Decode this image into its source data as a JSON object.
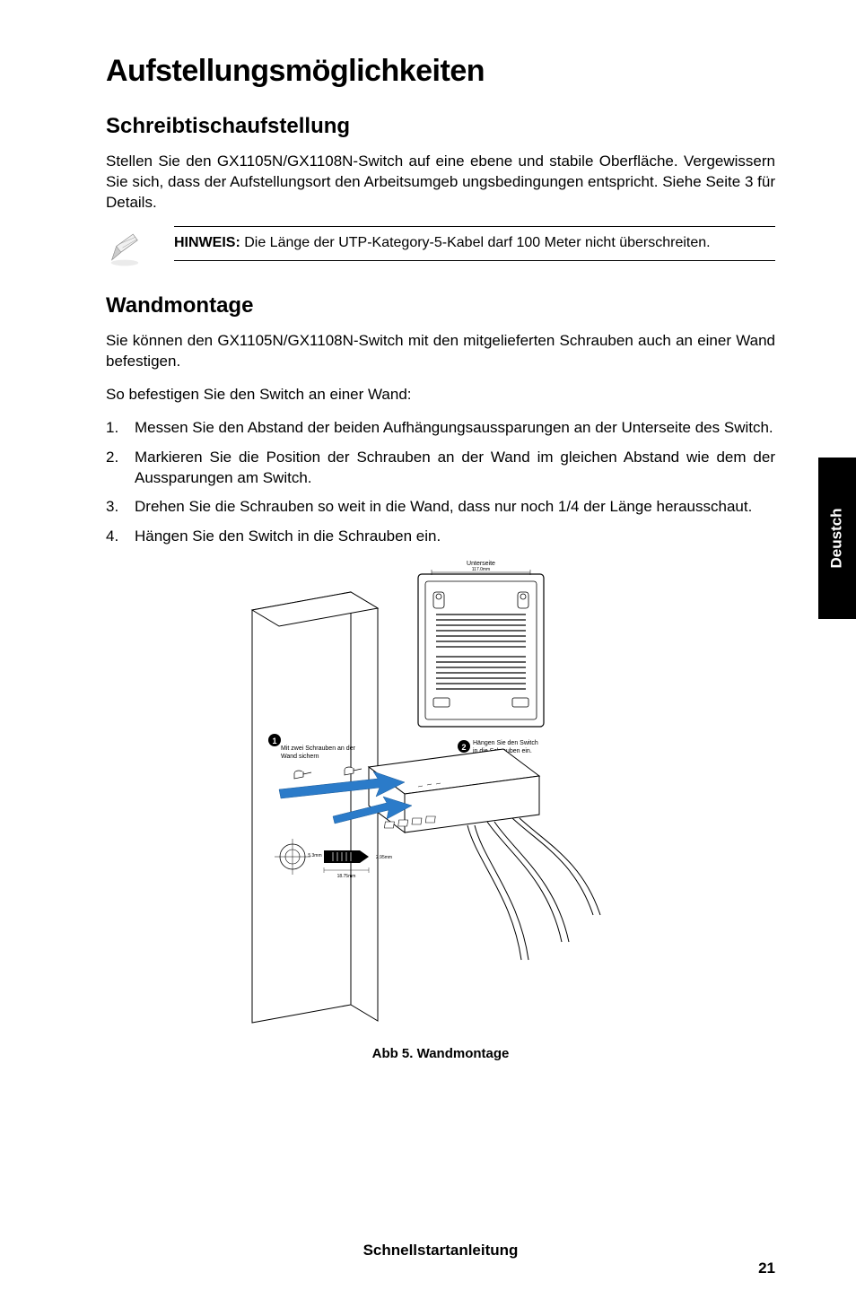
{
  "title": "Aufstellungsmöglichkeiten",
  "section1": {
    "heading": "Schreibtischaufstellung",
    "body": "Stellen Sie den GX1105N/GX1108N-Switch auf eine ebene und stabile Oberfläche. Vergewissern Sie sich, dass der Aufstellungsort den Arbeitsumgeb ungsbedingungen entspricht. Siehe Seite 3 für Details."
  },
  "note": {
    "label": "HINWEIS:",
    "text": " Die Länge der UTP-Kategory-5-Kabel darf 100 Meter nicht überschreiten."
  },
  "section2": {
    "heading": "Wandmontage",
    "intro": "Sie können den GX1105N/GX1108N-Switch mit den mitgelieferten Schrauben auch an einer Wand befestigen.",
    "instr": "So befestigen Sie den Switch an einer Wand:",
    "steps": [
      "Messen Sie den Abstand der beiden Aufhängungsaussparungen an der Unterseite des Switch.",
      "Markieren Sie die Position der Schrauben an der Wand im gleichen Abstand wie dem der Aussparungen am Switch.",
      "Drehen Sie die Schrauben so weit in die Wand, dass nur noch 1/4 der Länge herausschaut.",
      "Hängen Sie den Switch in die Schraubеn ein."
    ]
  },
  "figure": {
    "top_label": "Unterseite",
    "dim_117": "117.0mm",
    "callout1_num": "1",
    "callout1_text1": "Mit zwei Schrauben an der",
    "callout1_text2": "Wand sichern",
    "callout2_num": "2",
    "callout2_text1": "Hängen Sie den Switch",
    "callout2_text2": "in die Schrauben ein.",
    "dim_5_3": "5.3mm",
    "dim_2_95": "2.95mm",
    "dim_18_75": "18.75mm",
    "caption": "Abb 5. Wandmontage"
  },
  "side_tab": "Deustch",
  "footer": {
    "title": "Schnellstartanleitung",
    "page": "21"
  }
}
